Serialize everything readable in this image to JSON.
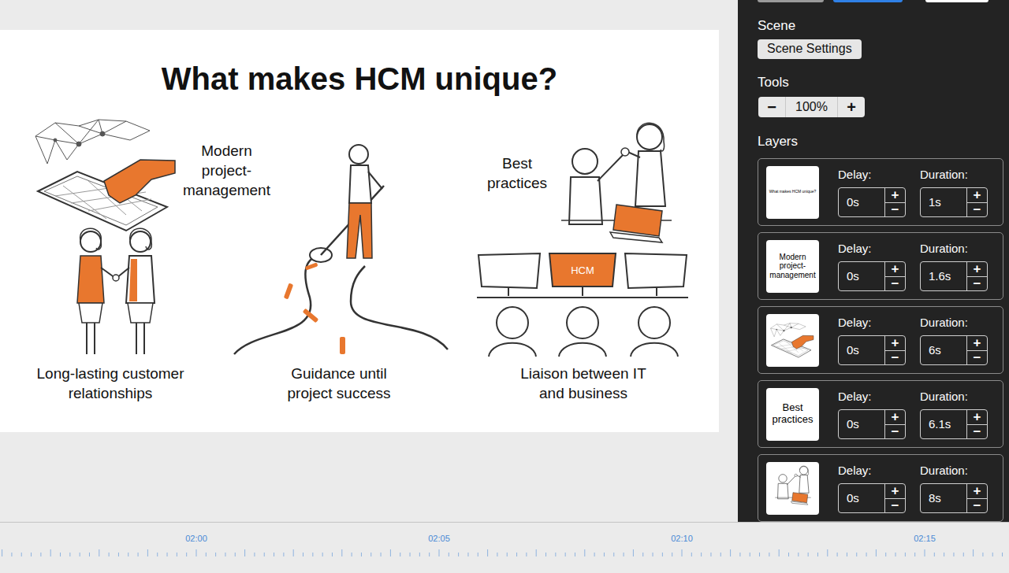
{
  "slide": {
    "title": "What makes HCM unique?",
    "items": [
      {
        "kind": "keyboard",
        "label": [
          "Modern",
          "project-",
          "management"
        ]
      },
      {
        "kind": "road",
        "label": [
          "Guidance until",
          "project success"
        ]
      },
      {
        "kind": "high-five",
        "label": [
          "Best",
          "practices"
        ]
      },
      {
        "kind": "handshake",
        "label": [
          "Long-lasting customer",
          "relationships"
        ]
      },
      {
        "kind": "monitors",
        "label": [
          "Liaison between IT",
          "and business"
        ],
        "screen_text": "HCM"
      }
    ]
  },
  "panel": {
    "scene_label": "Scene",
    "scene_button": "Scene Settings",
    "tools_label": "Tools",
    "zoom": {
      "minus": "−",
      "value": "100%",
      "plus": "+"
    },
    "layers_label": "Layers",
    "stepper": {
      "plus": "+",
      "minus": "−"
    },
    "layers": [
      {
        "thumb": {
          "kind": "text",
          "lines": [
            "What makes HCM unique?"
          ]
        },
        "delay_label": "Delay:",
        "delay": "0s",
        "duration_label": "Duration:",
        "duration": "1s"
      },
      {
        "thumb": {
          "kind": "text",
          "lines": [
            "Modern",
            "project-",
            "management"
          ]
        },
        "delay_label": "Delay:",
        "delay": "0s",
        "duration_label": "Duration:",
        "duration": "1.6s"
      },
      {
        "thumb": {
          "kind": "keyboard",
          "lines": []
        },
        "delay_label": "Delay:",
        "delay": "0s",
        "duration_label": "Duration:",
        "duration": "6s"
      },
      {
        "thumb": {
          "kind": "text",
          "lines": [
            "Best",
            "practices"
          ]
        },
        "delay_label": "Delay:",
        "delay": "0s",
        "duration_label": "Duration:",
        "duration": "6.1s"
      },
      {
        "thumb": {
          "kind": "high-five",
          "lines": []
        },
        "delay_label": "Delay:",
        "delay": "0s",
        "duration_label": "Duration:",
        "duration": "8s"
      }
    ]
  },
  "timeline": {
    "labels": [
      "02:00",
      "02:05",
      "02:10",
      "02:15"
    ]
  }
}
